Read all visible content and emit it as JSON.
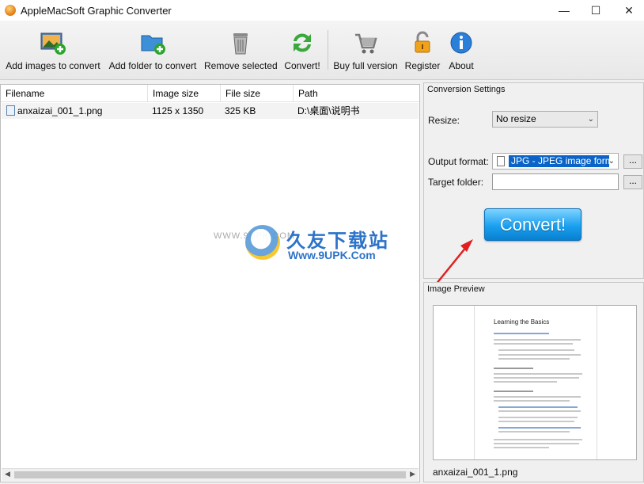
{
  "window": {
    "title": "AppleMacSoft Graphic Converter",
    "controls": {
      "minimize": "—",
      "maximize": "☐",
      "close": "✕"
    }
  },
  "toolbar": {
    "buttons": [
      {
        "label": "Add images to convert",
        "icon": "add-images-icon"
      },
      {
        "label": "Add folder to convert",
        "icon": "add-folder-icon"
      },
      {
        "label": "Remove selected",
        "icon": "trash-icon"
      },
      {
        "label": "Convert!",
        "icon": "convert-arrows-icon"
      },
      {
        "label": "Buy full version",
        "icon": "cart-icon"
      },
      {
        "label": "Register",
        "icon": "lock-icon"
      },
      {
        "label": "About",
        "icon": "info-icon"
      }
    ]
  },
  "filelist": {
    "columns": [
      "Filename",
      "Image size",
      "File size",
      "Path"
    ],
    "rows": [
      {
        "filename": "anxaizai_001_1.png",
        "image_size": "1125 x 1350",
        "file_size": "325 KB",
        "path": "D:\\桌面\\说明书"
      }
    ]
  },
  "settings": {
    "title": "Conversion Settings",
    "resize_label": "Resize:",
    "resize_value": "No resize",
    "output_label": "Output format:",
    "output_value": "JPG - JPEG image format",
    "target_label": "Target folder:",
    "target_value": "",
    "browse_label": "...",
    "convert_label": "Convert!"
  },
  "preview": {
    "title": "Image Preview",
    "heading": "Learning the Basics",
    "filename": "anxaizai_001_1.png"
  },
  "watermark": {
    "url": "WWW.9UPK.COM",
    "cn": "久友下载站",
    "url2": "Www.9UPK.Com"
  },
  "colors": {
    "accent": "#0a64c8",
    "convert_button": "#1aa0f0",
    "arrow": "#e02020"
  }
}
